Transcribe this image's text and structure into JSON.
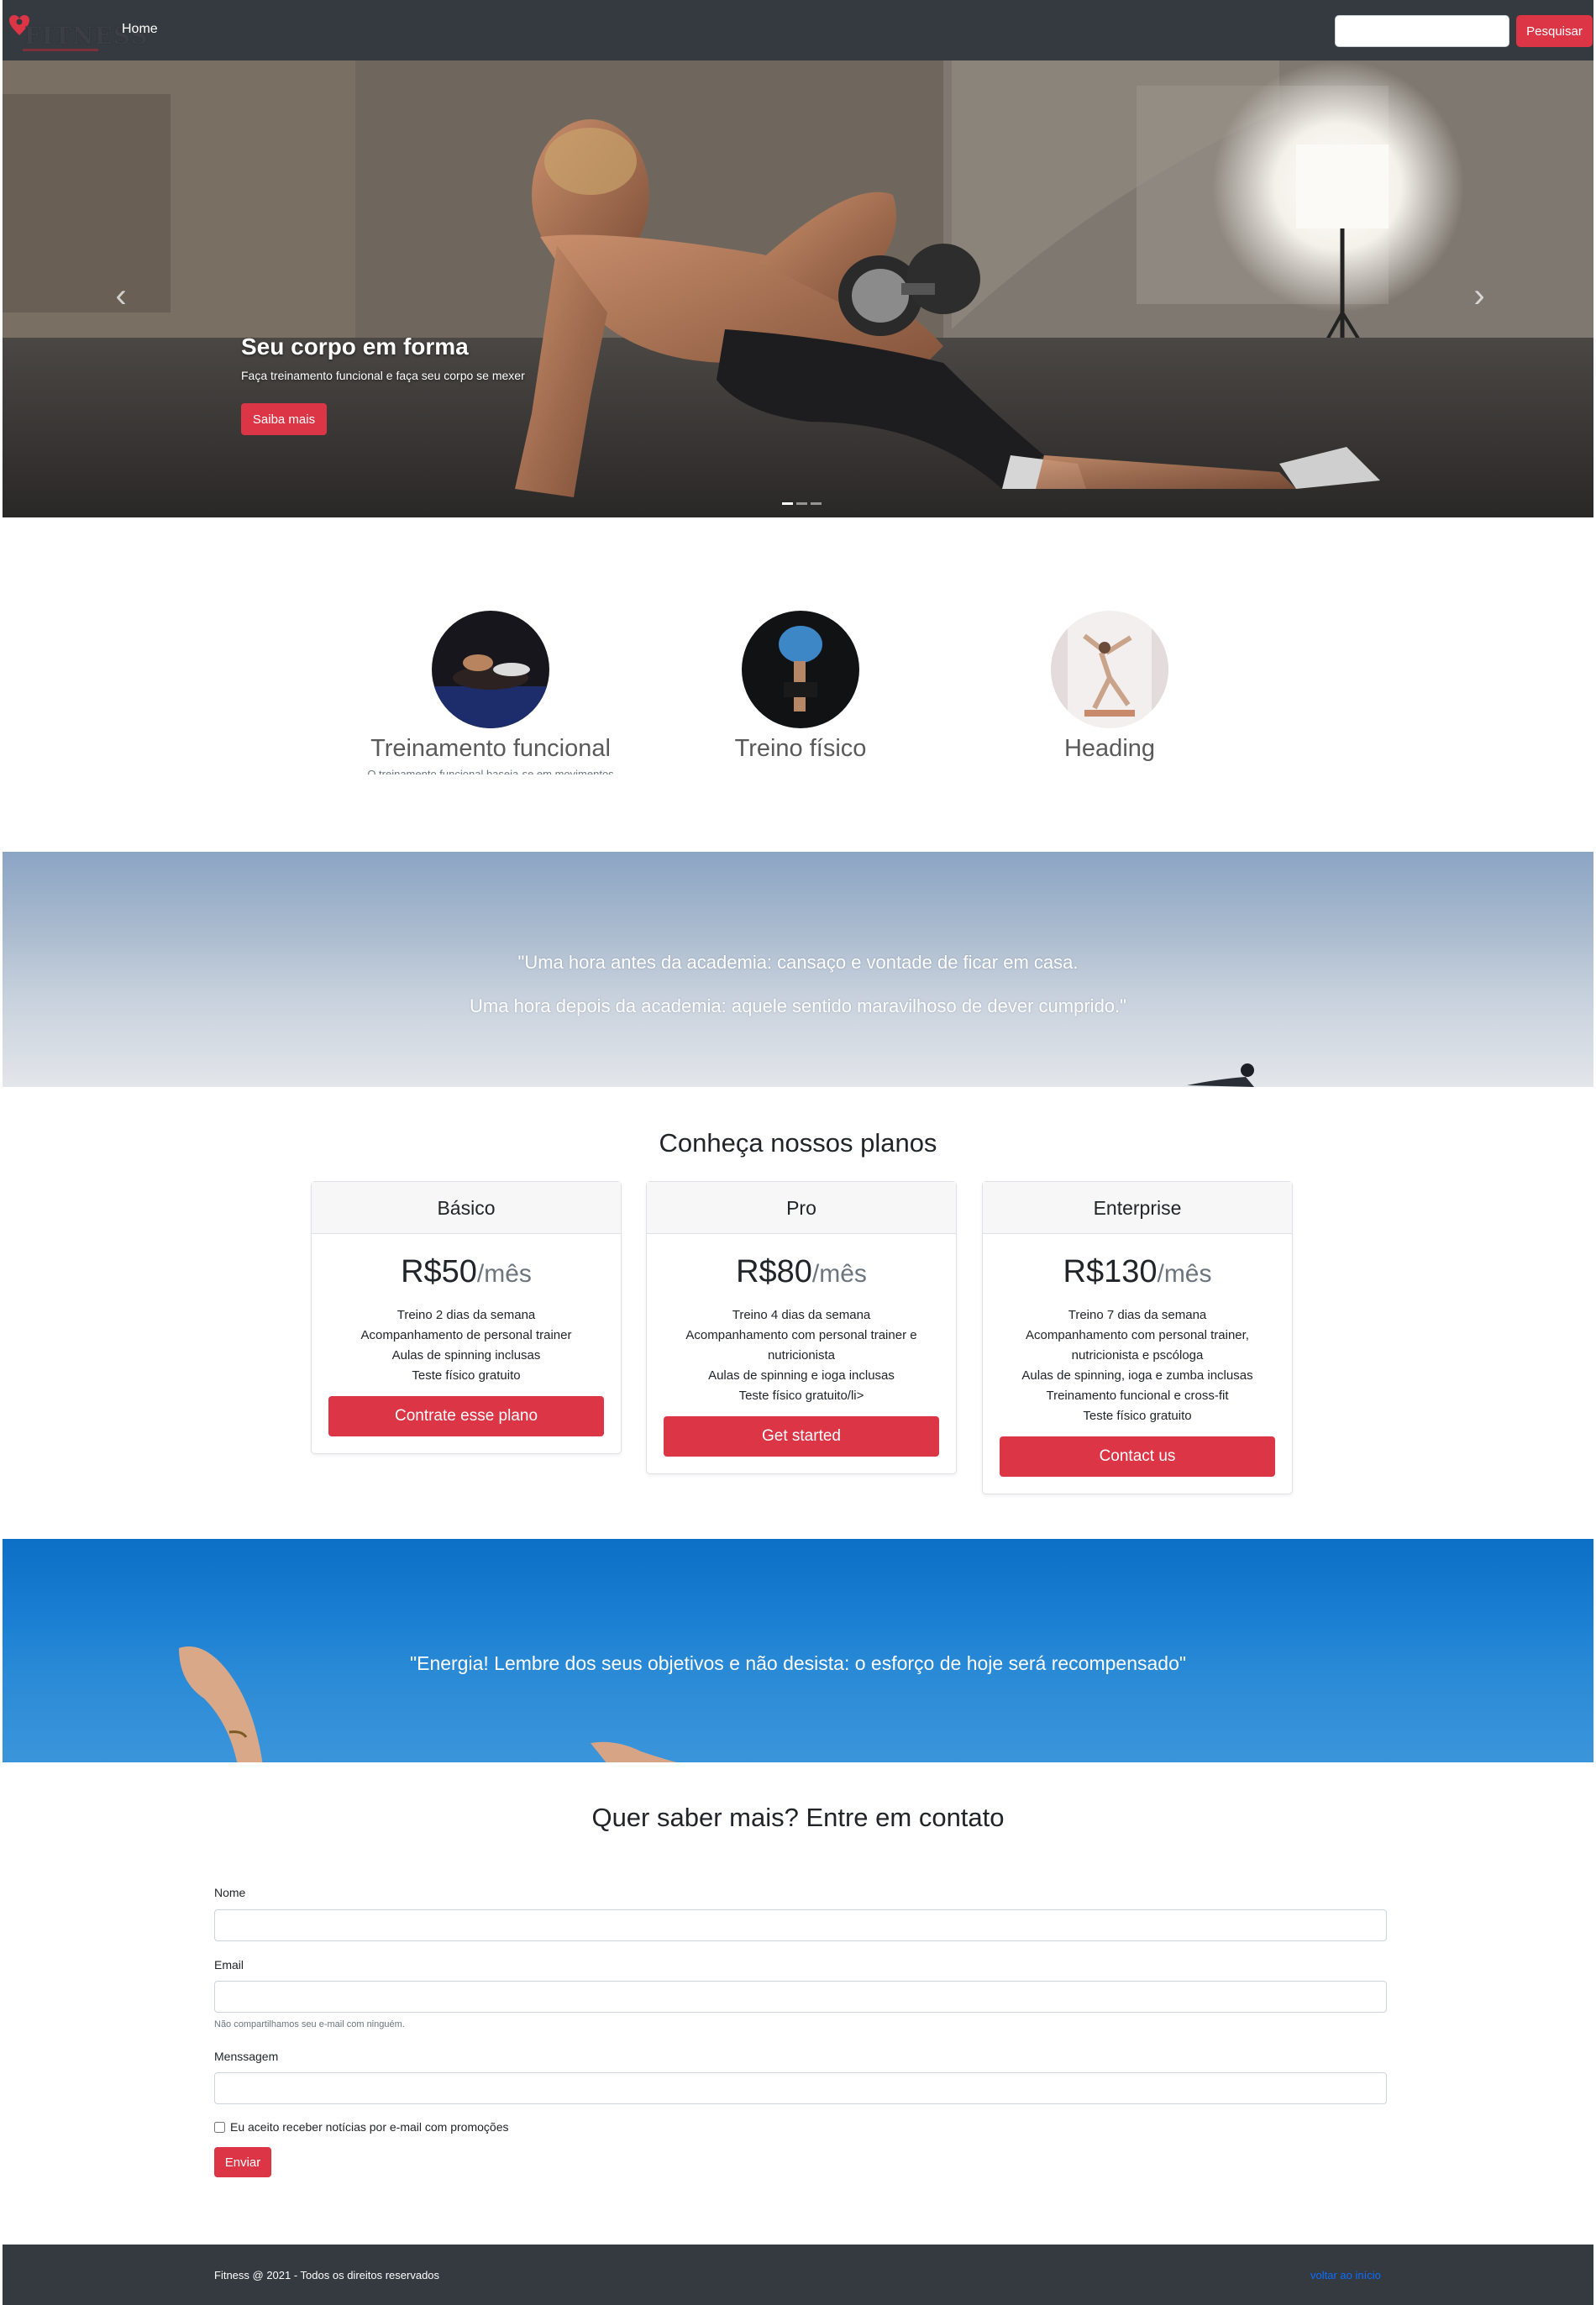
{
  "nav": {
    "brand": "FITNESS",
    "home_label": "Home",
    "search_placeholder": "",
    "search_button": "Pesquisar"
  },
  "hero": {
    "title": "Seu corpo em forma",
    "text": "Faça treinamento funcional e faça seu corpo se mexer",
    "button": "Saiba mais",
    "indicator_count": 3,
    "active_indicator": 1
  },
  "features": [
    {
      "title": "Treinamento funcional",
      "subtitle": "O treinamento funcional baseia-se em movimentos naturais"
    },
    {
      "title": "Treino físico",
      "subtitle": ""
    },
    {
      "title": "Heading",
      "subtitle": ""
    }
  ],
  "quote1": {
    "line1": "\"Uma hora antes da academia: cansaço e vontade de ficar em casa.",
    "line2": "Uma hora depois da academia: aquele sentido maravilhoso de dever cumprido.\""
  },
  "pricing": {
    "title": "Conheça nossos planos",
    "plans": [
      {
        "name": "Básico",
        "price": "R$50",
        "period": "/mês",
        "features": [
          "Treino 2 dias da semana",
          "Acompanhamento de personal trainer",
          "Aulas de spinning inclusas",
          "Teste físico gratuito"
        ],
        "button": "Contrate esse plano"
      },
      {
        "name": "Pro",
        "price": "R$80",
        "period": "/mês",
        "features": [
          "Treino 4 dias da semana",
          "Acompanhamento com personal trainer e nutricionista",
          "Aulas de spinning e ioga inclusas",
          "Teste físico gratuito/li>"
        ],
        "button": "Get started"
      },
      {
        "name": "Enterprise",
        "price": "R$130",
        "period": "/mês",
        "features": [
          "Treino 7 dias da semana",
          "Acompanhamento com personal trainer, nutricionista e pscóloga",
          "Aulas de spinning, ioga e zumba inclusas",
          "Treinamento funcional e cross-fit",
          "Teste físico gratuito"
        ],
        "button": "Contact us"
      }
    ]
  },
  "quote2": {
    "text": "\"Energia! Lembre dos seus objetivos e não desista: o esforço de hoje será recompensado\""
  },
  "contact": {
    "title": "Quer saber mais? Entre em contato",
    "name_label": "Nome",
    "email_label": "Email",
    "email_help": "Não compartilhamos seu e-mail com ninguém.",
    "message_label": "Menssagem",
    "checkbox_label": "Eu aceito receber notícias por e-mail com promoções",
    "checkbox_checked": false,
    "submit": "Enviar"
  },
  "footer": {
    "text": "Fitness @ 2021 - Todos os direitos reservados",
    "back_to_top": "voltar ao início"
  },
  "colors": {
    "navbar": "#343a40",
    "accent": "#dc3545",
    "link": "#0d6efd"
  }
}
